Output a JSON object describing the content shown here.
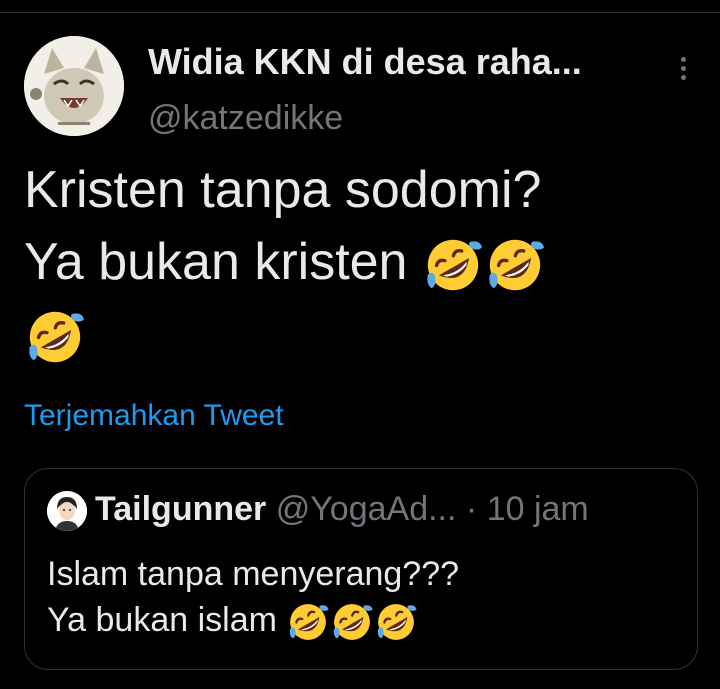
{
  "tweet": {
    "display_name": "Widia KKN di desa raha...",
    "handle": "@katzedikke",
    "text_line1": "Kristen tanpa sodomi?",
    "text_line2": "Ya bukan kristen",
    "translate_link": "Terjemahkan Tweet",
    "emoji": "rolling-on-floor-laughing"
  },
  "quoted": {
    "name": "Tailgunner",
    "handle": "@YogaAd...",
    "separator": "·",
    "time": "10 jam",
    "text_line1": "Islam tanpa menyerang???",
    "text_line2": "Ya bukan islam"
  },
  "colors": {
    "background": "#000000",
    "text": "#e7e9ea",
    "muted": "#71767b",
    "link": "#1d9bf0",
    "border": "#2f3336"
  }
}
